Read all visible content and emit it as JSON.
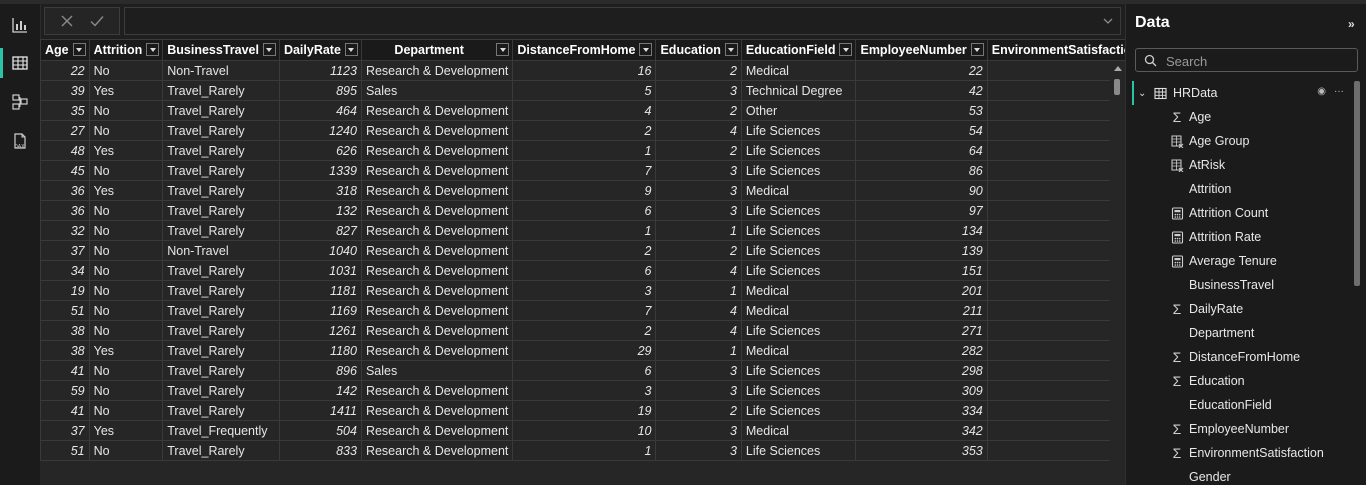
{
  "rail": {
    "items": [
      {
        "name": "report-view-icon",
        "active": false
      },
      {
        "name": "table-view-icon",
        "active": true
      },
      {
        "name": "model-view-icon",
        "active": false
      },
      {
        "name": "dax-query-view-icon",
        "active": false
      }
    ]
  },
  "formula": {
    "value": ""
  },
  "grid": {
    "columns": [
      {
        "label": "Age",
        "key": "age",
        "align": "num",
        "dropdown": true
      },
      {
        "label": "Attrition",
        "key": "attrition",
        "align": "text",
        "dropdown": true
      },
      {
        "label": "BusinessTravel",
        "key": "travel",
        "align": "text",
        "dropdown": true
      },
      {
        "label": "DailyRate",
        "key": "rate",
        "align": "num",
        "dropdown": true
      },
      {
        "label": "Department",
        "key": "dept",
        "align": "text",
        "dropdown": true
      },
      {
        "label": "DistanceFromHome",
        "key": "dist",
        "align": "num",
        "dropdown": true
      },
      {
        "label": "Education",
        "key": "edu",
        "align": "num",
        "dropdown": true
      },
      {
        "label": "EducationField",
        "key": "field",
        "align": "text",
        "dropdown": true
      },
      {
        "label": "EmployeeNumber",
        "key": "empno",
        "align": "num",
        "dropdown": true
      },
      {
        "label": "EnvironmentSatisfaction",
        "key": "env",
        "align": "num",
        "dropdown": false
      }
    ],
    "rows": [
      {
        "age": "22",
        "attrition": "No",
        "travel": "Non-Travel",
        "rate": "1123",
        "dept": "Research & Development",
        "dist": "16",
        "edu": "2",
        "field": "Medical",
        "empno": "22",
        "env": ""
      },
      {
        "age": "39",
        "attrition": "Yes",
        "travel": "Travel_Rarely",
        "rate": "895",
        "dept": "Sales",
        "dist": "5",
        "edu": "3",
        "field": "Technical Degree",
        "empno": "42",
        "env": ""
      },
      {
        "age": "35",
        "attrition": "No",
        "travel": "Travel_Rarely",
        "rate": "464",
        "dept": "Research & Development",
        "dist": "4",
        "edu": "2",
        "field": "Other",
        "empno": "53",
        "env": ""
      },
      {
        "age": "27",
        "attrition": "No",
        "travel": "Travel_Rarely",
        "rate": "1240",
        "dept": "Research & Development",
        "dist": "2",
        "edu": "4",
        "field": "Life Sciences",
        "empno": "54",
        "env": ""
      },
      {
        "age": "48",
        "attrition": "Yes",
        "travel": "Travel_Rarely",
        "rate": "626",
        "dept": "Research & Development",
        "dist": "1",
        "edu": "2",
        "field": "Life Sciences",
        "empno": "64",
        "env": ""
      },
      {
        "age": "45",
        "attrition": "No",
        "travel": "Travel_Rarely",
        "rate": "1339",
        "dept": "Research & Development",
        "dist": "7",
        "edu": "3",
        "field": "Life Sciences",
        "empno": "86",
        "env": ""
      },
      {
        "age": "36",
        "attrition": "Yes",
        "travel": "Travel_Rarely",
        "rate": "318",
        "dept": "Research & Development",
        "dist": "9",
        "edu": "3",
        "field": "Medical",
        "empno": "90",
        "env": ""
      },
      {
        "age": "36",
        "attrition": "No",
        "travel": "Travel_Rarely",
        "rate": "132",
        "dept": "Research & Development",
        "dist": "6",
        "edu": "3",
        "field": "Life Sciences",
        "empno": "97",
        "env": ""
      },
      {
        "age": "32",
        "attrition": "No",
        "travel": "Travel_Rarely",
        "rate": "827",
        "dept": "Research & Development",
        "dist": "1",
        "edu": "1",
        "field": "Life Sciences",
        "empno": "134",
        "env": ""
      },
      {
        "age": "37",
        "attrition": "No",
        "travel": "Non-Travel",
        "rate": "1040",
        "dept": "Research & Development",
        "dist": "2",
        "edu": "2",
        "field": "Life Sciences",
        "empno": "139",
        "env": ""
      },
      {
        "age": "34",
        "attrition": "No",
        "travel": "Travel_Rarely",
        "rate": "1031",
        "dept": "Research & Development",
        "dist": "6",
        "edu": "4",
        "field": "Life Sciences",
        "empno": "151",
        "env": ""
      },
      {
        "age": "19",
        "attrition": "No",
        "travel": "Travel_Rarely",
        "rate": "1181",
        "dept": "Research & Development",
        "dist": "3",
        "edu": "1",
        "field": "Medical",
        "empno": "201",
        "env": ""
      },
      {
        "age": "51",
        "attrition": "No",
        "travel": "Travel_Rarely",
        "rate": "1169",
        "dept": "Research & Development",
        "dist": "7",
        "edu": "4",
        "field": "Medical",
        "empno": "211",
        "env": ""
      },
      {
        "age": "38",
        "attrition": "No",
        "travel": "Travel_Rarely",
        "rate": "1261",
        "dept": "Research & Development",
        "dist": "2",
        "edu": "4",
        "field": "Life Sciences",
        "empno": "271",
        "env": ""
      },
      {
        "age": "38",
        "attrition": "Yes",
        "travel": "Travel_Rarely",
        "rate": "1180",
        "dept": "Research & Development",
        "dist": "29",
        "edu": "1",
        "field": "Medical",
        "empno": "282",
        "env": ""
      },
      {
        "age": "41",
        "attrition": "No",
        "travel": "Travel_Rarely",
        "rate": "896",
        "dept": "Sales",
        "dist": "6",
        "edu": "3",
        "field": "Life Sciences",
        "empno": "298",
        "env": ""
      },
      {
        "age": "59",
        "attrition": "No",
        "travel": "Travel_Rarely",
        "rate": "142",
        "dept": "Research & Development",
        "dist": "3",
        "edu": "3",
        "field": "Life Sciences",
        "empno": "309",
        "env": ""
      },
      {
        "age": "41",
        "attrition": "No",
        "travel": "Travel_Rarely",
        "rate": "1411",
        "dept": "Research & Development",
        "dist": "19",
        "edu": "2",
        "field": "Life Sciences",
        "empno": "334",
        "env": ""
      },
      {
        "age": "37",
        "attrition": "Yes",
        "travel": "Travel_Frequently",
        "rate": "504",
        "dept": "Research & Development",
        "dist": "10",
        "edu": "3",
        "field": "Medical",
        "empno": "342",
        "env": ""
      },
      {
        "age": "51",
        "attrition": "No",
        "travel": "Travel_Rarely",
        "rate": "833",
        "dept": "Research & Development",
        "dist": "1",
        "edu": "3",
        "field": "Life Sciences",
        "empno": "353",
        "env": ""
      }
    ]
  },
  "pane": {
    "title": "Data",
    "search_placeholder": "Search",
    "table_name": "HRData",
    "fields": [
      {
        "label": "Age",
        "icon": "sigma"
      },
      {
        "label": "Age Group",
        "icon": "calc-column"
      },
      {
        "label": "AtRisk",
        "icon": "calc-column"
      },
      {
        "label": "Attrition",
        "icon": "none"
      },
      {
        "label": "Attrition Count",
        "icon": "measure"
      },
      {
        "label": "Attrition Rate",
        "icon": "measure"
      },
      {
        "label": "Average Tenure",
        "icon": "measure"
      },
      {
        "label": "BusinessTravel",
        "icon": "none"
      },
      {
        "label": "DailyRate",
        "icon": "sigma"
      },
      {
        "label": "Department",
        "icon": "none"
      },
      {
        "label": "DistanceFromHome",
        "icon": "sigma"
      },
      {
        "label": "Education",
        "icon": "sigma"
      },
      {
        "label": "EducationField",
        "icon": "none"
      },
      {
        "label": "EmployeeNumber",
        "icon": "sigma"
      },
      {
        "label": "EnvironmentSatisfaction",
        "icon": "sigma"
      },
      {
        "label": "Gender",
        "icon": "none"
      }
    ]
  },
  "colors": {
    "accent": "#2cc4a6",
    "header_bg": "#1a1a1a",
    "cell_bg": "#262626"
  }
}
